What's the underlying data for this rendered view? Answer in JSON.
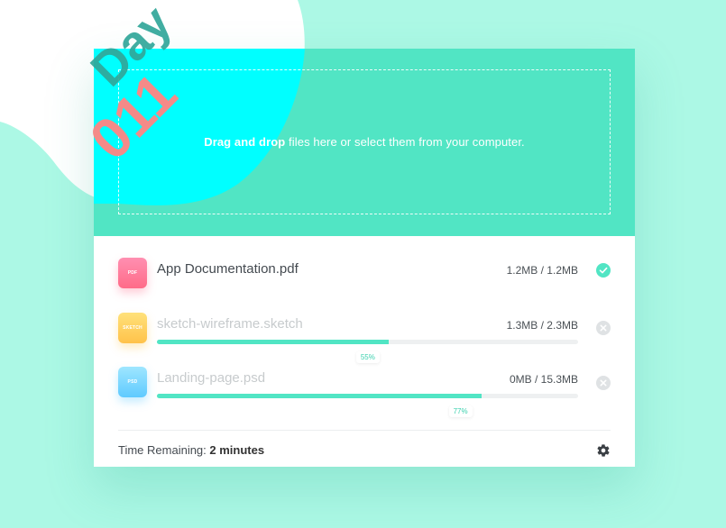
{
  "badge": {
    "day_label": "Day",
    "day_number": "011"
  },
  "drop_zone": {
    "text_bold": "Drag and drop",
    "text_rest": " files here or select them from your computer."
  },
  "files": [
    {
      "icon_label": "PDF",
      "icon_type": "pdf",
      "name": "App Documentation.pdf",
      "size": "1.2MB / 1.2MB",
      "status": "complete"
    },
    {
      "icon_label": "SKETCH",
      "icon_type": "sketch",
      "name": "sketch-wireframe.sketch",
      "size": "1.3MB / 2.3MB",
      "status": "uploading",
      "progress_percent": 55,
      "progress_label": "55%"
    },
    {
      "icon_label": "PSD",
      "icon_type": "psd",
      "name": "Landing-page.psd",
      "size": "0MB / 15.3MB",
      "status": "uploading",
      "progress_percent": 77,
      "progress_label": "77%"
    }
  ],
  "footer": {
    "time_label": "Time Remaining: ",
    "time_value": "2 minutes"
  },
  "colors": {
    "accent": "#51e5c4",
    "background": "#acf8e5",
    "cyan_blob": "#00ffff",
    "day_text": "#31a79a",
    "number_text": "#f48a88",
    "check": "#51e5c4",
    "cancel": "#d4d7d9"
  },
  "icons": {
    "complete": "check-circle-icon",
    "uploading": "close-circle-icon",
    "settings": "gear-icon"
  }
}
